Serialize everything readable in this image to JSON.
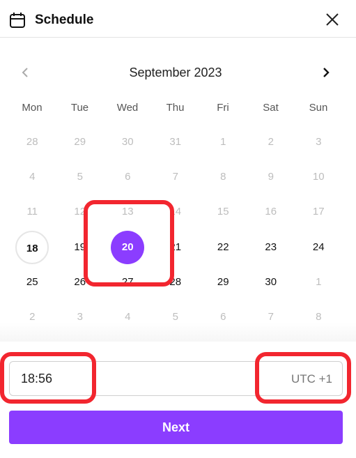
{
  "header": {
    "title": "Schedule",
    "icon": "calendar-icon",
    "close_icon": "close-icon"
  },
  "calendar": {
    "month_label": "September 2023",
    "prev_icon": "chevron-left-icon",
    "next_icon": "chevron-right-icon",
    "weekdays": [
      "Mon",
      "Tue",
      "Wed",
      "Thu",
      "Fri",
      "Sat",
      "Sun"
    ],
    "weeks": [
      [
        {
          "d": "28",
          "state": "muted"
        },
        {
          "d": "29",
          "state": "muted"
        },
        {
          "d": "30",
          "state": "muted"
        },
        {
          "d": "31",
          "state": "muted"
        },
        {
          "d": "1",
          "state": "muted"
        },
        {
          "d": "2",
          "state": "muted"
        },
        {
          "d": "3",
          "state": "muted"
        }
      ],
      [
        {
          "d": "4",
          "state": "muted"
        },
        {
          "d": "5",
          "state": "muted"
        },
        {
          "d": "6",
          "state": "muted"
        },
        {
          "d": "7",
          "state": "muted"
        },
        {
          "d": "8",
          "state": "muted"
        },
        {
          "d": "9",
          "state": "muted"
        },
        {
          "d": "10",
          "state": "muted"
        }
      ],
      [
        {
          "d": "11",
          "state": "muted"
        },
        {
          "d": "12",
          "state": "muted"
        },
        {
          "d": "13",
          "state": "muted"
        },
        {
          "d": "14",
          "state": "muted"
        },
        {
          "d": "15",
          "state": "muted"
        },
        {
          "d": "16",
          "state": "muted"
        },
        {
          "d": "17",
          "state": "muted"
        }
      ],
      [
        {
          "d": "18",
          "state": "today"
        },
        {
          "d": "19",
          "state": "active"
        },
        {
          "d": "20",
          "state": "selected"
        },
        {
          "d": "21",
          "state": "active"
        },
        {
          "d": "22",
          "state": "active"
        },
        {
          "d": "23",
          "state": "active"
        },
        {
          "d": "24",
          "state": "active"
        }
      ],
      [
        {
          "d": "25",
          "state": "active"
        },
        {
          "d": "26",
          "state": "active"
        },
        {
          "d": "27",
          "state": "active"
        },
        {
          "d": "28",
          "state": "active"
        },
        {
          "d": "29",
          "state": "active"
        },
        {
          "d": "30",
          "state": "active"
        },
        {
          "d": "1",
          "state": "muted"
        }
      ],
      [
        {
          "d": "2",
          "state": "muted"
        },
        {
          "d": "3",
          "state": "muted"
        },
        {
          "d": "4",
          "state": "muted"
        },
        {
          "d": "5",
          "state": "muted"
        },
        {
          "d": "6",
          "state": "muted"
        },
        {
          "d": "7",
          "state": "muted"
        },
        {
          "d": "8",
          "state": "muted"
        }
      ]
    ],
    "selected_day": "20",
    "today": "18"
  },
  "time": {
    "value": "18:56",
    "timezone": "UTC +1"
  },
  "actions": {
    "next_label": "Next"
  },
  "colors": {
    "accent": "#8b3dff",
    "highlight": "#f2262f"
  }
}
